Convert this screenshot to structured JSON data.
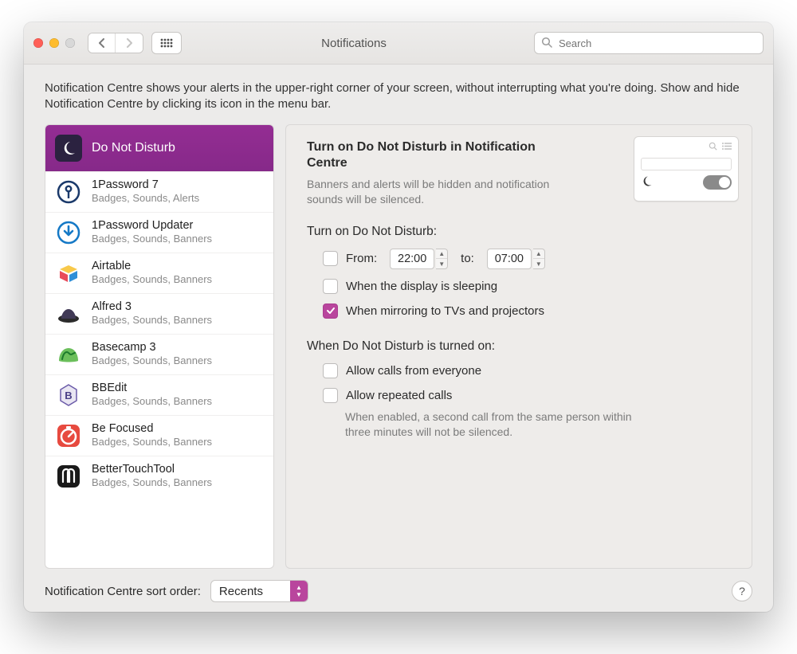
{
  "titlebar": {
    "title": "Notifications",
    "search_placeholder": "Search"
  },
  "intro": "Notification Centre shows your alerts in the upper-right corner of your screen, without interrupting what you're doing. Show and hide Notification Centre by clicking its icon in the menu bar.",
  "apps": [
    {
      "name": "Do Not Disturb",
      "sub": ""
    },
    {
      "name": "1Password 7",
      "sub": "Badges, Sounds, Alerts"
    },
    {
      "name": "1Password Updater",
      "sub": "Badges, Sounds, Banners"
    },
    {
      "name": "Airtable",
      "sub": "Badges, Sounds, Banners"
    },
    {
      "name": "Alfred 3",
      "sub": "Badges, Sounds, Banners"
    },
    {
      "name": "Basecamp 3",
      "sub": "Badges, Sounds, Banners"
    },
    {
      "name": "BBEdit",
      "sub": "Badges, Sounds, Banners"
    },
    {
      "name": "Be Focused",
      "sub": "Badges, Sounds, Banners"
    },
    {
      "name": "BetterTouchTool",
      "sub": "Badges, Sounds, Banners"
    }
  ],
  "detail": {
    "heading": "Turn on Do Not Disturb in Notification Centre",
    "heading_sub": "Banners and alerts will be hidden and notification sounds will be silenced.",
    "schedule_heading": "Turn on Do Not Disturb:",
    "from_label": "From:",
    "from_value": "22:00",
    "to_label": "to:",
    "to_value": "07:00",
    "opt_sleep": "When the display is sleeping",
    "opt_mirror": "When mirroring to TVs and projectors",
    "on_heading": "When Do Not Disturb is turned on:",
    "opt_calls_everyone": "Allow calls from everyone",
    "opt_repeated_calls": "Allow repeated calls",
    "repeated_hint": "When enabled, a second call from the same person within three minutes will not be silenced.",
    "checks": {
      "from": false,
      "sleep": false,
      "mirror": true,
      "calls_everyone": false,
      "repeated_calls": false
    }
  },
  "footer": {
    "sort_label": "Notification Centre sort order:",
    "sort_value": "Recents"
  },
  "colors": {
    "accent": "#b9459d",
    "selection": "#8d2a8f"
  }
}
